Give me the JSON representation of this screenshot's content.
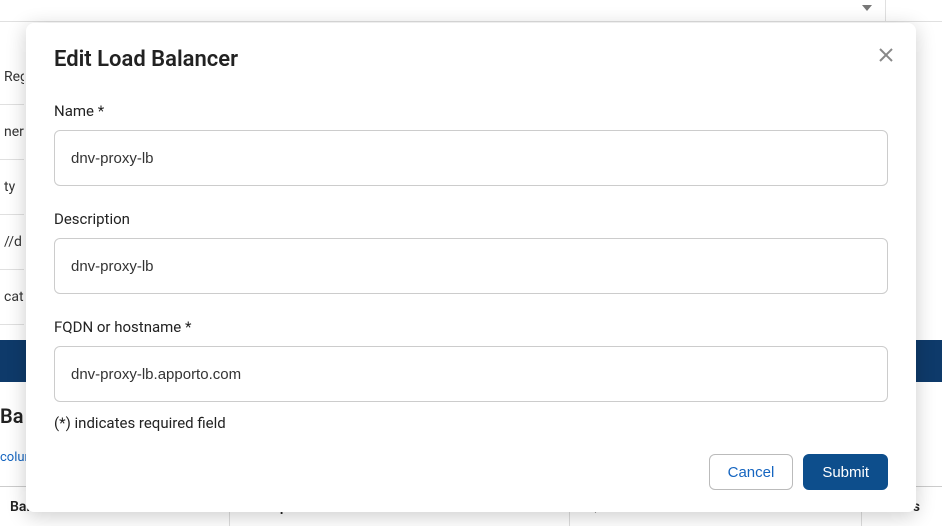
{
  "background": {
    "side_fragments": [
      "Reg",
      "ner",
      "ty",
      "//d",
      "cat"
    ],
    "balancers_heading": "Balancers",
    "columns_link": "columns",
    "table_headers": {
      "name": "Balancer",
      "description": "Description",
      "fqdn": "FQDN or hostname",
      "actions": "Actions"
    }
  },
  "modal": {
    "title": "Edit Load Balancer",
    "name_label": "Name *",
    "name_value": "dnv-proxy-lb",
    "description_label": "Description",
    "description_value": "dnv-proxy-lb",
    "fqdn_label": "FQDN or hostname *",
    "fqdn_value": "dnv-proxy-lb.apporto.com",
    "required_note": "(*) indicates required field",
    "cancel_label": "Cancel",
    "submit_label": "Submit"
  }
}
